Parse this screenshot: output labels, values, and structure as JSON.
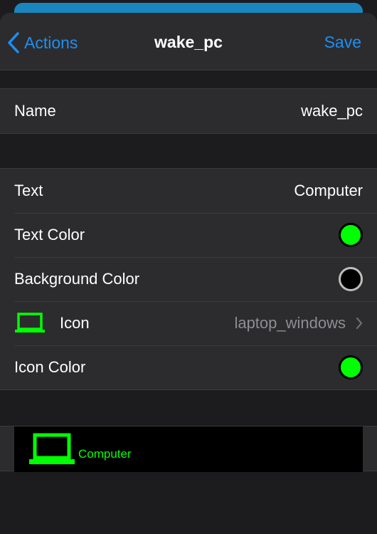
{
  "navbar": {
    "back_label": "Actions",
    "title": "wake_pc",
    "save_label": "Save"
  },
  "name_row": {
    "label": "Name",
    "value": "wake_pc"
  },
  "settings": {
    "text": {
      "label": "Text",
      "value": "Computer"
    },
    "text_color": {
      "label": "Text Color",
      "color": "#00ff00"
    },
    "background_color": {
      "label": "Background Color",
      "color": "#000000"
    },
    "icon": {
      "label": "Icon",
      "value": "laptop_windows",
      "icon_name": "laptop-icon"
    },
    "icon_color": {
      "label": "Icon Color",
      "color": "#00ff00"
    }
  },
  "preview": {
    "text": "Computer",
    "icon_name": "laptop-icon",
    "text_color": "#00ff00",
    "background": "#000000"
  },
  "colors": {
    "accent": "#1d8ff3",
    "green": "#00ff00"
  }
}
